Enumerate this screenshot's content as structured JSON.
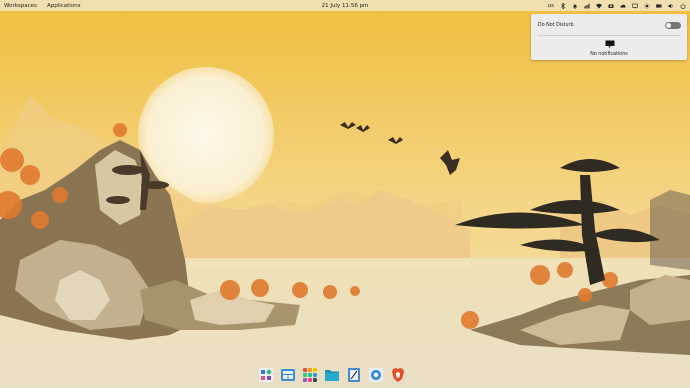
{
  "topbar": {
    "workspaces_label": "Workspaces",
    "applications_label": "Applications",
    "clock": "21 July 11:56 pm",
    "keyboard_layout": "us",
    "icons": [
      "keyboard-layout",
      "bluetooth-icon",
      "bell-icon",
      "network-icon",
      "wifi-icon",
      "camera-icon",
      "cloud-icon",
      "display-icon",
      "sun-icon",
      "battery-icon",
      "volume-icon",
      "power-icon"
    ]
  },
  "notifications": {
    "dnd_label": "Do Not Disturb",
    "dnd_enabled": false,
    "empty_text": "No notifications"
  },
  "dock": {
    "apps": [
      "app-center-icon",
      "files-preview-icon",
      "app-grid-icon",
      "folder-icon",
      "text-editor-icon",
      "settings-icon",
      "brave-browser-icon"
    ]
  },
  "colors": {
    "topbar": "#f1dfb0",
    "sky_top": "#f0bf3d",
    "sky_bottom": "#f5dc9a",
    "sun": "#fbf3dc",
    "water": "#ece2c4",
    "autumn": "#e07a2e",
    "brave": "#e2502c"
  }
}
